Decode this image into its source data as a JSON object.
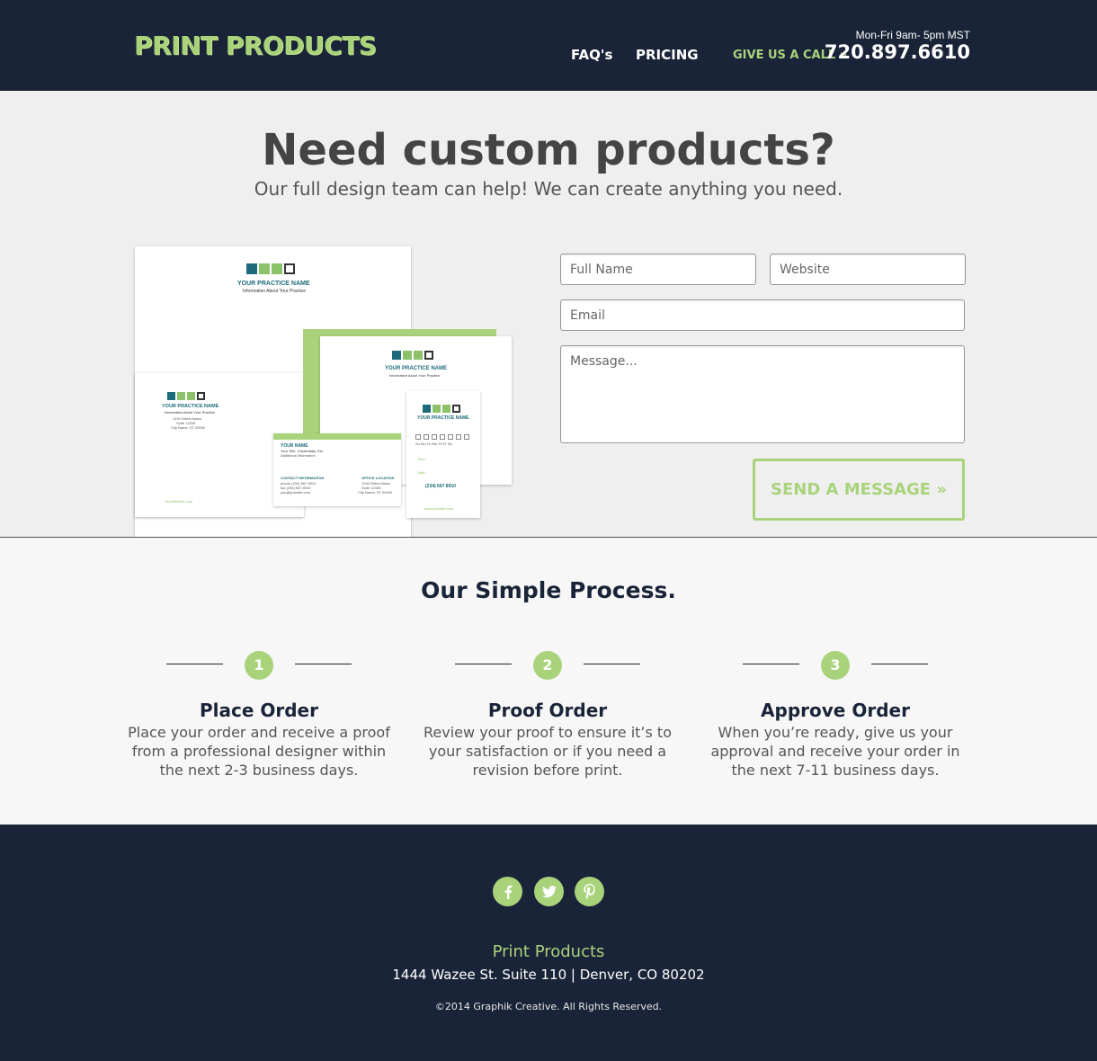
{
  "header": {
    "logo": "PRINT PRODUCTS",
    "nav": {
      "faq": "FAQ's",
      "pricing": "PRICING"
    },
    "hours": "Mon-Fri  9am- 5pm MST",
    "call_label": "GIVE US A CALL »",
    "phone": "720.897.6610"
  },
  "hero": {
    "title": "Need custom products?",
    "subtitle": "Our full design team can help! We can create anything you need."
  },
  "mockup": {
    "practice_name": "YOUR PRACTICE NAME",
    "practice_tagline": "Information About Your Practice",
    "envelope_address": [
      "1234 Street Name",
      "Suite 12345",
      "City Name, ST 00000"
    ],
    "website": "YourWebsite.com",
    "biz_name": "YOUR NAME",
    "biz_title": "Your Title, Credentials, Etc.",
    "biz_info": "Additional Information",
    "biz_contact_label": "CONTACT INFORMATION",
    "biz_contact": [
      "phone (234) 567 8910",
      "fax (234) 567 8910",
      "you@yoursite.com"
    ],
    "biz_office_label": "OFFICE LOCATION",
    "biz_office": [
      "1234 Street Name",
      "Suite 12345",
      "City Name, ST 00000"
    ],
    "appt_header": "YOUR PRACTICE NAME",
    "appt_days": "Su  Mo  Tu  We  Th  Fr  Sa",
    "appt_time": "Time:",
    "appt_date": "Date:",
    "appt_phone": "(234) 567 8910",
    "appt_site": "www.yoursite.com"
  },
  "form": {
    "name_placeholder": "Full Name",
    "website_placeholder": "Website",
    "email_placeholder": "Email",
    "message_placeholder": "Message...",
    "submit": "SEND A MESSAGE »"
  },
  "process": {
    "title": "Our Simple Process.",
    "steps": [
      {
        "num": "1",
        "title": "Place Order",
        "text": "Place your order and receive a proof from a professional designer within the next 2-3 business days."
      },
      {
        "num": "2",
        "title": "Proof Order",
        "text": "Review your proof to ensure it’s to your satisfaction or if you need a revision before print."
      },
      {
        "num": "3",
        "title": "Approve Order",
        "text": "When you’re ready, give us your approval and receive your order in the next 7-11 business days."
      }
    ]
  },
  "footer": {
    "social": [
      "facebook-icon",
      "twitter-icon",
      "pinterest-icon"
    ],
    "brand": "Print Products",
    "address": "1444 Wazee St. Suite 110 | Denver, CO 80202",
    "copyright": "©2014 Graphik Creative. All Rights Reserved."
  },
  "colors": {
    "navy": "#1a2438",
    "accent_green": "#a9d37b",
    "hero_bg": "#efefef",
    "process_bg": "#f7f7f7",
    "brand_teal": "#1d6b7a"
  }
}
